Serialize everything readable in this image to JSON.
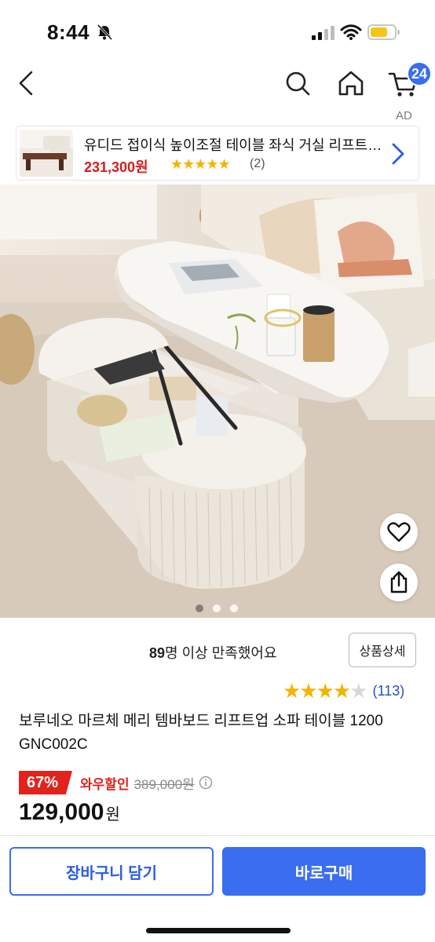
{
  "status_bar": {
    "time": "8:44",
    "icons": [
      "bell-slash-icon",
      "signal-icon",
      "wifi-icon",
      "battery-icon"
    ],
    "battery_color": "#f5c518"
  },
  "nav": {
    "icons": [
      "back-icon",
      "search-icon",
      "home-icon",
      "cart-icon"
    ],
    "cart_count": "24",
    "accent": "#3a6df0"
  },
  "ad": {
    "label": "AD",
    "title": "유디드 접이식 높이조절 테이블 좌식 거실 리프트업 테이블",
    "price": "231,300원",
    "stars": "★★★★★",
    "review_count": "(2)"
  },
  "gallery": {
    "total_images": 3,
    "current_index": 1
  },
  "satisfaction": {
    "count": "89",
    "text": "명 이상 만족했어요",
    "detail_button": "상품상세"
  },
  "rating": {
    "filled_stars": "★★★★",
    "empty_stars": "★",
    "value": 4,
    "review_count": "(113)"
  },
  "product": {
    "title": "보루네오 마르체 메리 템바보드 리프트업 소파 테이블 1200 GNC002C",
    "discount_percent": "67%",
    "discount_label": "와우할인",
    "original_price": "389,000원",
    "price": "129,000",
    "price_unit": "원",
    "discount_color": "#e3221d"
  },
  "actions": {
    "add_to_cart": "장바구니 담기",
    "buy_now": "바로구매"
  }
}
